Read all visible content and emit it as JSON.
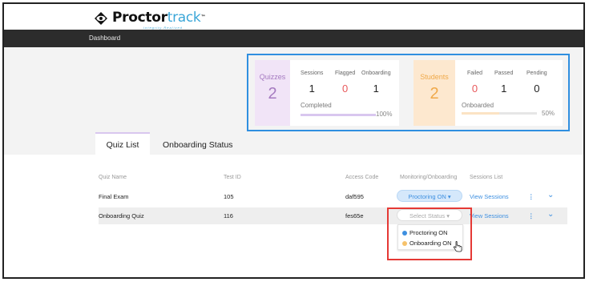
{
  "brand": {
    "name_part1": "Proctor",
    "name_part2": "track",
    "tm": "™",
    "tagline": "Integrity Realized"
  },
  "nav": {
    "dashboard": "Dashboard"
  },
  "quizzes_card": {
    "title": "Quizzes",
    "count": "2",
    "stats": [
      {
        "label": "Sessions",
        "value": "1"
      },
      {
        "label": "Flagged",
        "value": "0"
      },
      {
        "label": "Onboarding",
        "value": "1"
      }
    ],
    "progress_label": "Completed",
    "progress_pct": "100%",
    "progress_value": 1.0
  },
  "students_card": {
    "title": "Students",
    "count": "2",
    "stats": [
      {
        "label": "Failed",
        "value": "0"
      },
      {
        "label": "Passed",
        "value": "1"
      },
      {
        "label": "Pending",
        "value": "0"
      }
    ],
    "progress_label": "Onboarded",
    "progress_pct": "50%",
    "progress_value": 0.5
  },
  "tabs": [
    {
      "label": "Quiz List",
      "active": true
    },
    {
      "label": "Onboarding Status",
      "active": false
    }
  ],
  "table": {
    "headers": [
      "Quiz Name",
      "Test ID",
      "Access Code",
      "Monitoring/Onboarding",
      "Sessions List"
    ],
    "rows": [
      {
        "name": "Final Exam",
        "test_id": "105",
        "access_code": "daf595",
        "status": "Proctoring ON ▾",
        "sessions": "View Sessions"
      },
      {
        "name": "Onboarding Quiz",
        "test_id": "116",
        "access_code": "fes65e",
        "status": "Select Status ▾",
        "sessions": "View Sessions"
      }
    ]
  },
  "dropdown": {
    "options": [
      {
        "label": "Proctoring ON",
        "dot_color": "#3d8fe0"
      },
      {
        "label": "Onboarding ON",
        "dot_color": "#f6c26b"
      }
    ]
  },
  "colors": {
    "navbar": "#2c2c2c",
    "accent_blue": "#3d8fe0",
    "quiz_purple": "#a57ac0",
    "student_orange": "#f0a94a",
    "highlight_red": "#e53935"
  },
  "icons": {
    "more": "⋮",
    "expand": "⌄"
  }
}
